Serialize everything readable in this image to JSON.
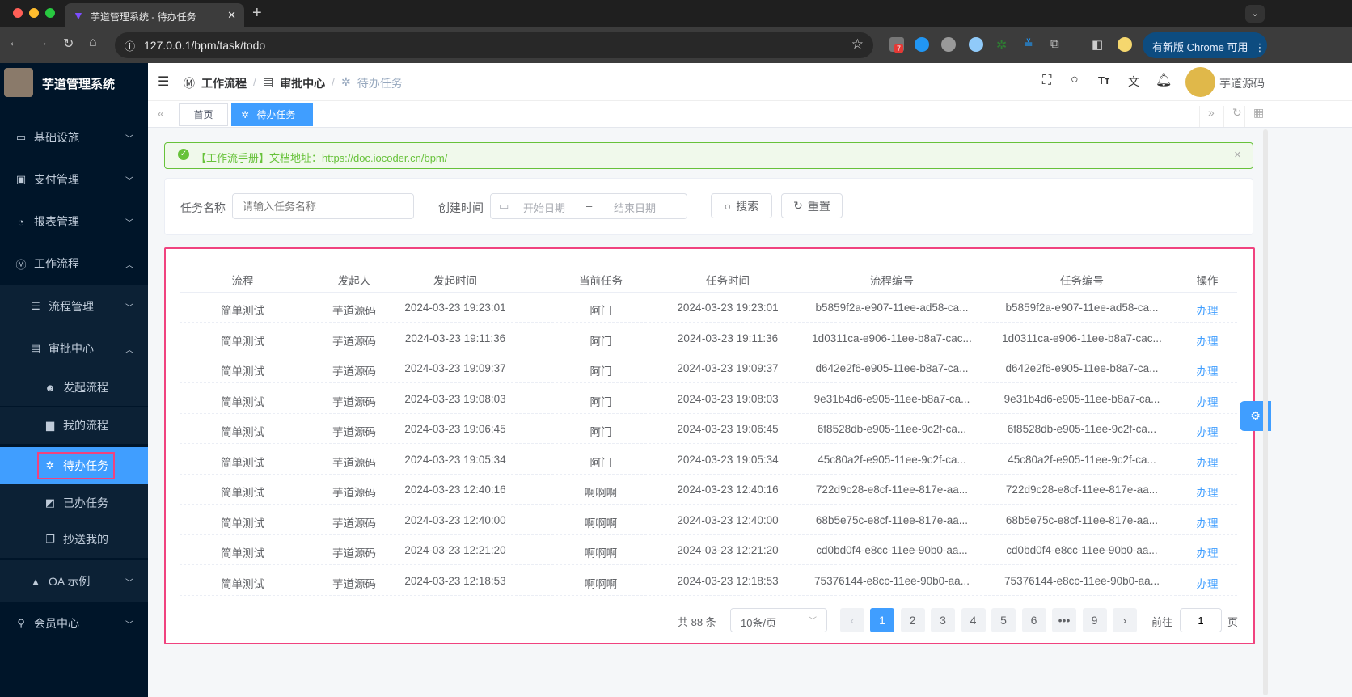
{
  "browser": {
    "tab_title": "芋道管理系统 - 待办任务",
    "url": "127.0.0.1/bpm/task/todo",
    "update_label": "有新版 Chrome 可用",
    "ext_badge": "7"
  },
  "sidebar": {
    "title": "芋道管理系统",
    "items": [
      {
        "label": "基础设施",
        "icon": "monitor-icon"
      },
      {
        "label": "支付管理",
        "icon": "payment-icon"
      },
      {
        "label": "报表管理",
        "icon": "chart-icon"
      },
      {
        "label": "工作流程",
        "icon": "workflow-icon"
      },
      {
        "label": "流程管理",
        "icon": "list-icon"
      },
      {
        "label": "审批中心",
        "icon": "server-icon"
      },
      {
        "label": "发起流程",
        "icon": "smile-icon"
      },
      {
        "label": "我的流程",
        "icon": "document-icon"
      },
      {
        "label": "待办任务",
        "icon": "gear-icon"
      },
      {
        "label": "已办任务",
        "icon": "checker-icon"
      },
      {
        "label": "抄送我的",
        "icon": "copy-icon"
      },
      {
        "label": "OA 示例",
        "icon": "oa-icon"
      },
      {
        "label": "会员中心",
        "icon": "bike-icon"
      }
    ]
  },
  "header": {
    "breadcrumb": [
      "工作流程",
      "审批中心",
      "待办任务"
    ],
    "username": "芋道源码"
  },
  "tags": [
    "首页",
    "待办任务"
  ],
  "alert": {
    "text": "【工作流手册】文档地址：https://doc.iocoder.cn/bpm/"
  },
  "search": {
    "name_label": "任务名称",
    "name_placeholder": "请输入任务名称",
    "time_label": "创建时间",
    "start_placeholder": "开始日期",
    "sep": "–",
    "end_placeholder": "结束日期",
    "search_btn": "搜索",
    "reset_btn": "重置"
  },
  "table": {
    "columns": [
      "流程",
      "发起人",
      "发起时间",
      "当前任务",
      "任务时间",
      "流程编号",
      "任务编号",
      "操作"
    ],
    "rows": [
      [
        "简单测试",
        "芋道源码",
        "2024-03-23 19:23:01",
        "阿门",
        "2024-03-23 19:23:01",
        "b5859f2a-e907-11ee-ad58-ca...",
        "b5859f2a-e907-11ee-ad58-ca...",
        "办理"
      ],
      [
        "简单测试",
        "芋道源码",
        "2024-03-23 19:11:36",
        "阿门",
        "2024-03-23 19:11:36",
        "1d0311ca-e906-11ee-b8a7-cac...",
        "1d0311ca-e906-11ee-b8a7-cac...",
        "办理"
      ],
      [
        "简单测试",
        "芋道源码",
        "2024-03-23 19:09:37",
        "阿门",
        "2024-03-23 19:09:37",
        "d642e2f6-e905-11ee-b8a7-ca...",
        "d642e2f6-e905-11ee-b8a7-ca...",
        "办理"
      ],
      [
        "简单测试",
        "芋道源码",
        "2024-03-23 19:08:03",
        "阿门",
        "2024-03-23 19:08:03",
        "9e31b4d6-e905-11ee-b8a7-ca...",
        "9e31b4d6-e905-11ee-b8a7-ca...",
        "办理"
      ],
      [
        "简单测试",
        "芋道源码",
        "2024-03-23 19:06:45",
        "阿门",
        "2024-03-23 19:06:45",
        "6f8528db-e905-11ee-9c2f-ca...",
        "6f8528db-e905-11ee-9c2f-ca...",
        "办理"
      ],
      [
        "简单测试",
        "芋道源码",
        "2024-03-23 19:05:34",
        "阿门",
        "2024-03-23 19:05:34",
        "45c80a2f-e905-11ee-9c2f-ca...",
        "45c80a2f-e905-11ee-9c2f-ca...",
        "办理"
      ],
      [
        "简单测试",
        "芋道源码",
        "2024-03-23 12:40:16",
        "啊啊啊",
        "2024-03-23 12:40:16",
        "722d9c28-e8cf-11ee-817e-aa...",
        "722d9c28-e8cf-11ee-817e-aa...",
        "办理"
      ],
      [
        "简单测试",
        "芋道源码",
        "2024-03-23 12:40:00",
        "啊啊啊",
        "2024-03-23 12:40:00",
        "68b5e75c-e8cf-11ee-817e-aa...",
        "68b5e75c-e8cf-11ee-817e-aa...",
        "办理"
      ],
      [
        "简单测试",
        "芋道源码",
        "2024-03-23 12:21:20",
        "啊啊啊",
        "2024-03-23 12:21:20",
        "cd0bd0f4-e8cc-11ee-90b0-aa...",
        "cd0bd0f4-e8cc-11ee-90b0-aa...",
        "办理"
      ],
      [
        "简单测试",
        "芋道源码",
        "2024-03-23 12:18:53",
        "啊啊啊",
        "2024-03-23 12:18:53",
        "75376144-e8cc-11ee-90b0-aa...",
        "75376144-e8cc-11ee-90b0-aa...",
        "办理"
      ]
    ]
  },
  "pagination": {
    "total": "共 88 条",
    "page_size": "10条/页",
    "pages": [
      "1",
      "2",
      "3",
      "4",
      "5",
      "6",
      "•••",
      "9"
    ],
    "current": "1",
    "goto_label": "前往",
    "goto_value": "1",
    "page_suffix": "页"
  },
  "colors": {
    "primary": "#409eff",
    "sidebar": "#001529",
    "success": "#67c23a",
    "highlight": "#f0437f"
  }
}
